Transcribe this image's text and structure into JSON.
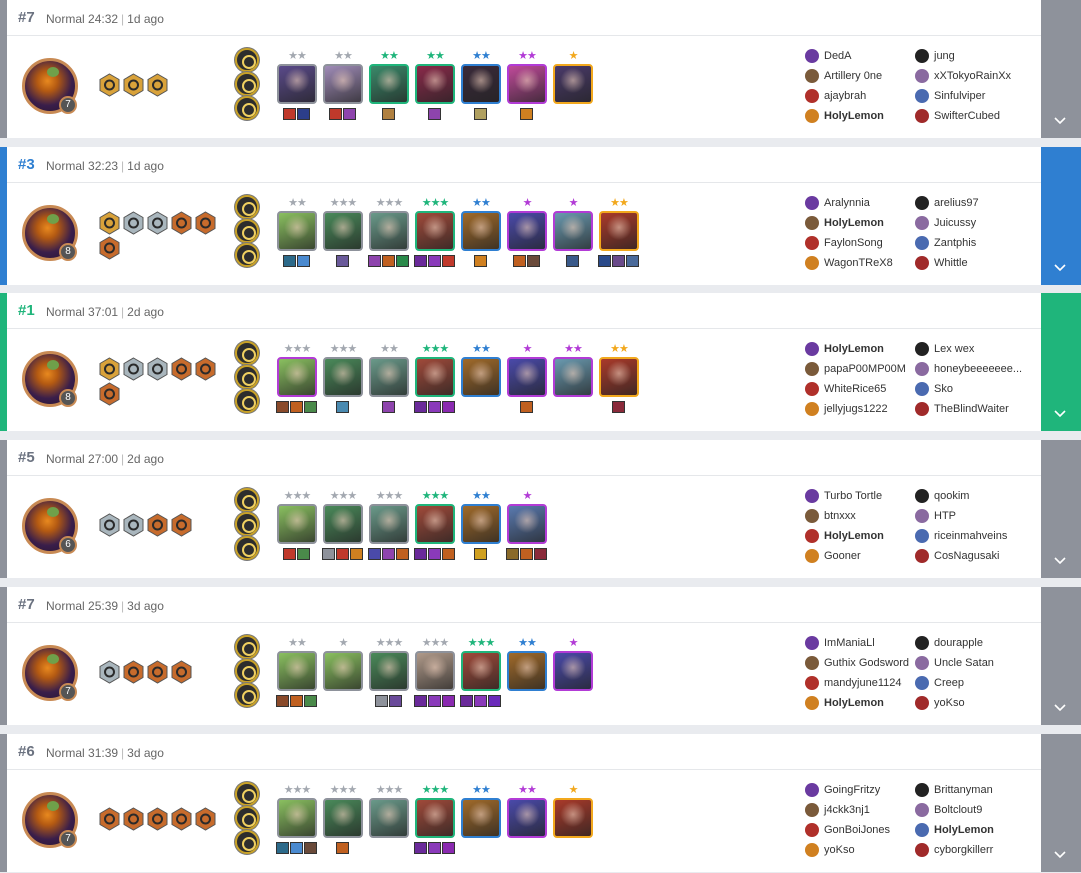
{
  "matches": [
    {
      "place": "#7",
      "mode": "Normal",
      "duration": "24:32",
      "ago": "1d ago",
      "accent": "#8e929b",
      "level": "7",
      "traits": [
        "gold-hex-trait-icon",
        "gold-hex-trait-icon",
        "gold-hex-trait-icon"
      ],
      "augments": [
        "augment-icon",
        "augment-icon",
        "augment-icon"
      ],
      "units": [
        {
          "stars": "★★",
          "star_color": "#a3a8b0",
          "border": "#8e929b",
          "color": "#5a4a8a",
          "items": [
            "#c0392b",
            "#2c3e8a"
          ]
        },
        {
          "stars": "★★",
          "star_color": "#a3a8b0",
          "border": "#8e929b",
          "color": "#a08cb8",
          "items": [
            "#c0392b",
            "#8e44ad"
          ]
        },
        {
          "stars": "★★",
          "star_color": "#1fb57b",
          "border": "#1fb57b",
          "color": "#3a8a6a",
          "items": [
            "#b08040"
          ]
        },
        {
          "stars": "★★",
          "star_color": "#1fb57b",
          "border": "#1fb57b",
          "color": "#8a2a4a",
          "items": [
            "#8e44ad"
          ]
        },
        {
          "stars": "★★",
          "star_color": "#2f7fd1",
          "border": "#2f7fd1",
          "color": "#3a2a3a",
          "items": [
            "#b0a060"
          ]
        },
        {
          "stars": "★★",
          "star_color": "#b23bd6",
          "border": "#b23bd6",
          "color": "#c04a9a",
          "items": [
            "#d08020"
          ]
        },
        {
          "stars": "★",
          "star_color": "#f2a81d",
          "border": "#f2a81d",
          "color": "#4a3a6a",
          "items": []
        }
      ],
      "players": [
        "DedA",
        "Artillery 0ne",
        "ajaybrah",
        "HolyLemon",
        "jung",
        "xXTokyoRainXx",
        "Sinfulviper",
        "SwifterCubed"
      ]
    },
    {
      "place": "#3",
      "mode": "Normal",
      "duration": "32:23",
      "ago": "1d ago",
      "accent": "#2f7fd1",
      "level": "8",
      "traits": [
        "gold-hex-trait-icon",
        "silver-hex-trait-icon",
        "silver-hex-trait-icon",
        "bronze-hex-trait-icon",
        "bronze-hex-trait-icon",
        "bronze-hex-trait-icon"
      ],
      "augments": [
        "augment-icon",
        "augment-icon",
        "augment-icon"
      ],
      "units": [
        {
          "stars": "★★",
          "star_color": "#a3a8b0",
          "border": "#8e929b",
          "color": "#8ac060",
          "items": [
            "#2c6a8a",
            "#4a8ad0"
          ]
        },
        {
          "stars": "★★★",
          "star_color": "#a3a8b0",
          "border": "#8e929b",
          "color": "#4a8a5a",
          "items": [
            "#6a5a9a"
          ]
        },
        {
          "stars": "★★★",
          "star_color": "#a3a8b0",
          "border": "#8e929b",
          "color": "#6a9a8a",
          "items": [
            "#8e44ad",
            "#c06020",
            "#2a8a4a"
          ]
        },
        {
          "stars": "★★★",
          "star_color": "#1fb57b",
          "border": "#1fb57b",
          "color": "#a04a3a",
          "items": [
            "#6a2a9a",
            "#8a3aba",
            "#c0392b"
          ]
        },
        {
          "stars": "★★",
          "star_color": "#2f7fd1",
          "border": "#2f7fd1",
          "color": "#a06a2a",
          "items": [
            "#d08020"
          ]
        },
        {
          "stars": "★",
          "star_color": "#b23bd6",
          "border": "#b23bd6",
          "color": "#4a4aaa",
          "items": [
            "#c06020",
            "#6a4a3a"
          ]
        },
        {
          "stars": "★",
          "star_color": "#b23bd6",
          "border": "#b23bd6",
          "color": "#6a9ab0",
          "items": [
            "#3a5a8a"
          ]
        },
        {
          "stars": "★★",
          "star_color": "#f2a81d",
          "border": "#f2a81d",
          "color": "#aa3a2a",
          "items": [
            "#2a4a8a",
            "#6a4a8a",
            "#4a6a9a"
          ]
        }
      ],
      "players": [
        "Aralynnia",
        "HolyLemon",
        "FaylonSong",
        "WagonTReX8",
        "arelius97",
        "Juicussy",
        "Zantphis",
        "Whittle"
      ]
    },
    {
      "place": "#1",
      "mode": "Normal",
      "duration": "37:01",
      "ago": "2d ago",
      "accent": "#1fb57b",
      "level": "8",
      "traits": [
        "gold-hex-trait-icon",
        "silver-hex-trait-icon",
        "silver-hex-trait-icon",
        "bronze-hex-trait-icon",
        "bronze-hex-trait-icon",
        "bronze-hex-trait-icon"
      ],
      "augments": [
        "augment-icon",
        "augment-icon",
        "augment-icon"
      ],
      "units": [
        {
          "stars": "★★★",
          "star_color": "#a3a8b0",
          "border": "#b23bd6",
          "color": "#8ac060",
          "items": [
            "#8a4a2a",
            "#c06020",
            "#4a8a4a"
          ]
        },
        {
          "stars": "★★★",
          "star_color": "#a3a8b0",
          "border": "#8e929b",
          "color": "#4a8a5a",
          "items": [
            "#4a8ab0"
          ]
        },
        {
          "stars": "★★",
          "star_color": "#a3a8b0",
          "border": "#8e929b",
          "color": "#6a9a8a",
          "items": [
            "#8e44ad"
          ]
        },
        {
          "stars": "★★★",
          "star_color": "#1fb57b",
          "border": "#1fb57b",
          "color": "#a04a3a",
          "items": [
            "#6a2a9a",
            "#8a3aba",
            "#8a2ab0"
          ]
        },
        {
          "stars": "★★",
          "star_color": "#2f7fd1",
          "border": "#2f7fd1",
          "color": "#a06a2a",
          "items": []
        },
        {
          "stars": "★",
          "star_color": "#b23bd6",
          "border": "#b23bd6",
          "color": "#4a4aaa",
          "items": [
            "#c06020"
          ]
        },
        {
          "stars": "★★",
          "star_color": "#b23bd6",
          "border": "#b23bd6",
          "color": "#6a9ab0",
          "items": []
        },
        {
          "stars": "★★",
          "star_color": "#f2a81d",
          "border": "#f2a81d",
          "color": "#aa3a2a",
          "items": [
            "#8a2a3a"
          ]
        }
      ],
      "players": [
        "HolyLemon",
        "papaP00MP00M",
        "WhiteRice65",
        "jellyjugs1222",
        "Lex wex",
        "honeybeeeeeee...",
        "Sko",
        "TheBlindWaiter"
      ]
    },
    {
      "place": "#5",
      "mode": "Normal",
      "duration": "27:00",
      "ago": "2d ago",
      "accent": "#8e929b",
      "level": "6",
      "traits": [
        "silver-hex-trait-icon",
        "silver-hex-trait-icon",
        "bronze-hex-trait-icon",
        "bronze-hex-trait-icon"
      ],
      "augments": [
        "augment-icon",
        "augment-icon",
        "augment-icon"
      ],
      "units": [
        {
          "stars": "★★★",
          "star_color": "#a3a8b0",
          "border": "#8e929b",
          "color": "#8ac060",
          "items": [
            "#c0392b",
            "#4a8a4a"
          ]
        },
        {
          "stars": "★★★",
          "star_color": "#a3a8b0",
          "border": "#8e929b",
          "color": "#4a8a5a",
          "items": [
            "#8e929b",
            "#c0392b",
            "#d08020"
          ]
        },
        {
          "stars": "★★★",
          "star_color": "#a3a8b0",
          "border": "#8e929b",
          "color": "#6a9a8a",
          "items": [
            "#4a4aaa",
            "#8e44ad",
            "#c06020"
          ]
        },
        {
          "stars": "★★★",
          "star_color": "#1fb57b",
          "border": "#1fb57b",
          "color": "#a04a3a",
          "items": [
            "#6a2a9a",
            "#8a3aba",
            "#c06020"
          ]
        },
        {
          "stars": "★★",
          "star_color": "#2f7fd1",
          "border": "#2f7fd1",
          "color": "#a06a2a",
          "items": [
            "#d0a020"
          ]
        },
        {
          "stars": "★",
          "star_color": "#b23bd6",
          "border": "#b23bd6",
          "color": "#5a7ab0",
          "items": [
            "#8a6a2a",
            "#c06020",
            "#8a2a3a"
          ]
        }
      ],
      "players": [
        "Turbo Tortle",
        "btnxxx",
        "HolyLemon",
        "Gooner",
        "qookim",
        "HTP",
        "riceinmahveins",
        "CosNagusaki"
      ]
    },
    {
      "place": "#7",
      "mode": "Normal",
      "duration": "25:39",
      "ago": "3d ago",
      "accent": "#8e929b",
      "level": "7",
      "traits": [
        "silver-hex-trait-icon",
        "bronze-hex-trait-icon",
        "bronze-hex-trait-icon",
        "bronze-hex-trait-icon"
      ],
      "augments": [
        "augment-icon",
        "augment-icon",
        "augment-icon"
      ],
      "units": [
        {
          "stars": "★★",
          "star_color": "#a3a8b0",
          "border": "#8e929b",
          "color": "#8ac060",
          "items": [
            "#8a4a2a",
            "#c06020",
            "#4a8a4a"
          ]
        },
        {
          "stars": "★",
          "star_color": "#a3a8b0",
          "border": "#8e929b",
          "color": "#8ac060",
          "items": []
        },
        {
          "stars": "★★★",
          "star_color": "#a3a8b0",
          "border": "#8e929b",
          "color": "#4a8a5a",
          "items": [
            "#8e929b",
            "#6a4a9a"
          ]
        },
        {
          "stars": "★★★",
          "star_color": "#a3a8b0",
          "border": "#8e929b",
          "color": "#b09a8a",
          "items": [
            "#6a2a9a",
            "#8a3aba",
            "#8a2ab0"
          ]
        },
        {
          "stars": "★★★",
          "star_color": "#1fb57b",
          "border": "#1fb57b",
          "color": "#a04a3a",
          "items": [
            "#6a2a9a",
            "#8a3aba",
            "#6a2aba"
          ]
        },
        {
          "stars": "★★",
          "star_color": "#2f7fd1",
          "border": "#2f7fd1",
          "color": "#a06a2a",
          "items": []
        },
        {
          "stars": "★",
          "star_color": "#b23bd6",
          "border": "#b23bd6",
          "color": "#4a4aaa",
          "items": []
        }
      ],
      "players": [
        "ImManiaLl",
        "Guthix Godsword",
        "mandyjune1124",
        "HolyLemon",
        "dourapple",
        "Uncle Satan",
        "Creep",
        "yoKso"
      ]
    },
    {
      "place": "#6",
      "mode": "Normal",
      "duration": "31:39",
      "ago": "3d ago",
      "accent": "#8e929b",
      "level": "7",
      "traits": [
        "bronze-hex-trait-icon",
        "bronze-hex-trait-icon",
        "bronze-hex-trait-icon",
        "bronze-hex-trait-icon",
        "bronze-hex-trait-icon"
      ],
      "augments": [
        "augment-icon",
        "augment-icon",
        "augment-icon"
      ],
      "units": [
        {
          "stars": "★★★",
          "star_color": "#a3a8b0",
          "border": "#8e929b",
          "color": "#8ac060",
          "items": [
            "#2c6a8a",
            "#4a8ad0",
            "#6a4a3a"
          ]
        },
        {
          "stars": "★★★",
          "star_color": "#a3a8b0",
          "border": "#8e929b",
          "color": "#4a8a5a",
          "items": [
            "#c06020"
          ]
        },
        {
          "stars": "★★★",
          "star_color": "#a3a8b0",
          "border": "#8e929b",
          "color": "#6a9a8a",
          "items": []
        },
        {
          "stars": "★★★",
          "star_color": "#1fb57b",
          "border": "#1fb57b",
          "color": "#a04a3a",
          "items": [
            "#6a2a9a",
            "#8a3aba",
            "#8a2ab0"
          ]
        },
        {
          "stars": "★★",
          "star_color": "#2f7fd1",
          "border": "#2f7fd1",
          "color": "#a06a2a",
          "items": []
        },
        {
          "stars": "★★",
          "star_color": "#b23bd6",
          "border": "#b23bd6",
          "color": "#4a4aaa",
          "items": []
        },
        {
          "stars": "★",
          "star_color": "#f2a81d",
          "border": "#f2a81d",
          "color": "#aa3a2a",
          "items": []
        }
      ],
      "players": [
        "GoingFritzy",
        "j4ckk3nj1",
        "GonBoiJones",
        "yoKso",
        "Brittanyman",
        "Boltclout9",
        "HolyLemon",
        "cyborgkillerr"
      ]
    }
  ],
  "current_player": "HolyLemon"
}
